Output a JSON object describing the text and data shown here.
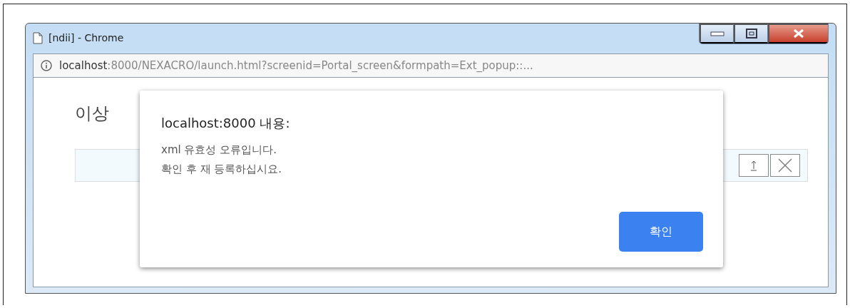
{
  "window": {
    "title": "[ndii] - Chrome"
  },
  "address_bar": {
    "host": "localhost",
    "rest": ":8000/NEXACRO/launch.html?screenid=Portal_screen&formpath=Ext_popup::..."
  },
  "page": {
    "heading": "이상"
  },
  "dialog": {
    "title": "localhost:8000 내용:",
    "message_lines": [
      "xml 유효성 오류입니다.",
      "확인 후 재 등록하십시요."
    ],
    "button": "확인"
  }
}
